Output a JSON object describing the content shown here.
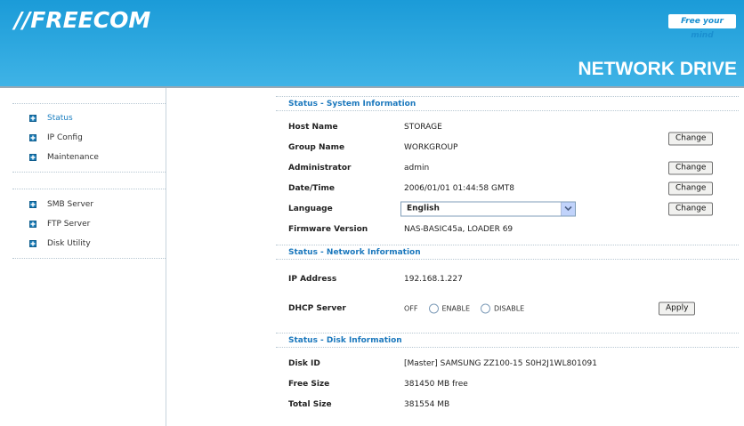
{
  "header": {
    "logo": "//FREECOM",
    "tagline": "Free your mind",
    "product": "NETWORK DRIVE"
  },
  "sidebar": {
    "groups": [
      {
        "items": [
          {
            "label": "Status",
            "active": true
          },
          {
            "label": "IP Config",
            "active": false
          },
          {
            "label": "Maintenance",
            "active": false
          }
        ]
      },
      {
        "items": [
          {
            "label": "SMB Server",
            "active": false
          },
          {
            "label": "FTP Server",
            "active": false
          },
          {
            "label": "Disk Utility",
            "active": false
          }
        ]
      }
    ]
  },
  "system": {
    "title": "Status - System Information",
    "host_name_label": "Host Name",
    "host_name": "STORAGE",
    "group_name_label": "Group Name",
    "group_name": "WORKGROUP",
    "administrator_label": "Administrator",
    "administrator": "admin",
    "datetime_label": "Date/Time",
    "datetime": "2006/01/01 01:44:58 GMT8",
    "language_label": "Language",
    "language": "English",
    "firmware_label": "Firmware Version",
    "firmware": "NAS-BASIC45a, LOADER 69",
    "change_label": "Change"
  },
  "network": {
    "title": "Status - Network Information",
    "ip_label": "IP Address",
    "ip": "192.168.1.227",
    "dhcp_label": "DHCP Server",
    "dhcp_state": "OFF",
    "enable_label": "ENABLE",
    "disable_label": "DISABLE",
    "apply_label": "Apply"
  },
  "disk": {
    "title": "Status - Disk Information",
    "disk_id_label": "Disk ID",
    "disk_id": "[Master] SAMSUNG ZZ100-15 S0H2J1WL801091",
    "free_label": "Free Size",
    "free": "381450 MB free",
    "total_label": "Total Size",
    "total": "381554 MB"
  },
  "colors": {
    "header_blue": "#2ba6de",
    "section_title": "#1b78bd"
  }
}
